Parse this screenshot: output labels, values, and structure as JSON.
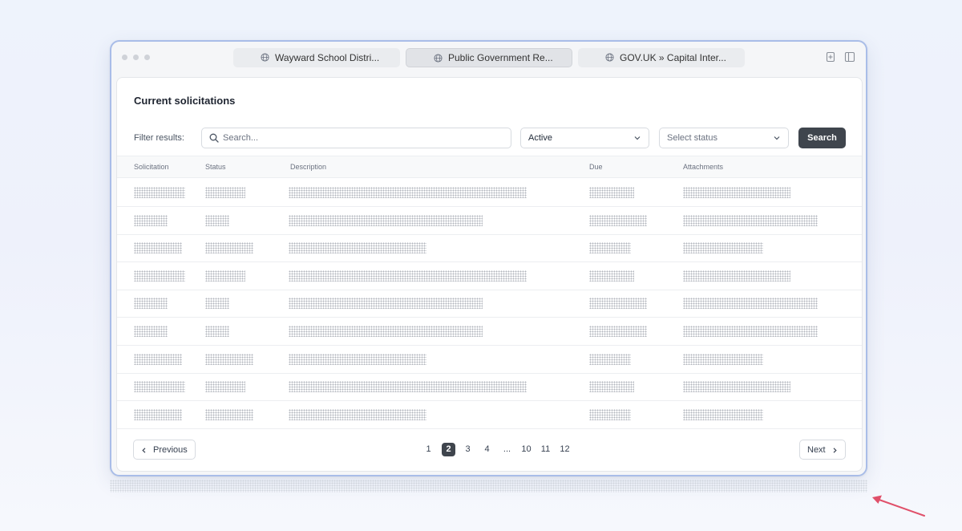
{
  "browser": {
    "tabs": [
      {
        "title": "Wayward School Distri...",
        "active": false
      },
      {
        "title": "Public Government Re...",
        "active": true
      },
      {
        "title": "GOV.UK » Capital Inter...",
        "active": false
      }
    ]
  },
  "page": {
    "title": "Current solicitations",
    "filter_label": "Filter results:",
    "search_placeholder": "Search...",
    "search_value": "",
    "filter_select_value": "Active",
    "status_select_placeholder": "Select status",
    "search_button": "Search"
  },
  "table": {
    "columns": [
      "Solicitation",
      "Status",
      "Description",
      "Due",
      "Attachments"
    ],
    "rows_note_hidden": true,
    "rows": [
      [
        "",
        "",
        "",
        "",
        ""
      ],
      [
        "",
        "",
        "",
        "",
        ""
      ],
      [
        "",
        "",
        "",
        "",
        ""
      ],
      [
        "",
        "",
        "",
        "",
        ""
      ],
      [
        "",
        "",
        "",
        "",
        ""
      ],
      [
        "",
        "",
        "",
        "",
        ""
      ],
      [
        "",
        "",
        "",
        "",
        ""
      ],
      [
        "",
        "",
        "",
        "",
        ""
      ],
      [
        "",
        "",
        "",
        "",
        ""
      ]
    ]
  },
  "pagination": {
    "previous_label": "Previous",
    "next_label": "Next",
    "pages": [
      "1",
      "2",
      "3",
      "4",
      "...",
      "10",
      "11",
      "12"
    ],
    "current_page": "2"
  },
  "colors": {
    "accent_dark": "#3f454d",
    "window_border": "#a9bde8",
    "annotation_arrow": "#e0506a"
  }
}
